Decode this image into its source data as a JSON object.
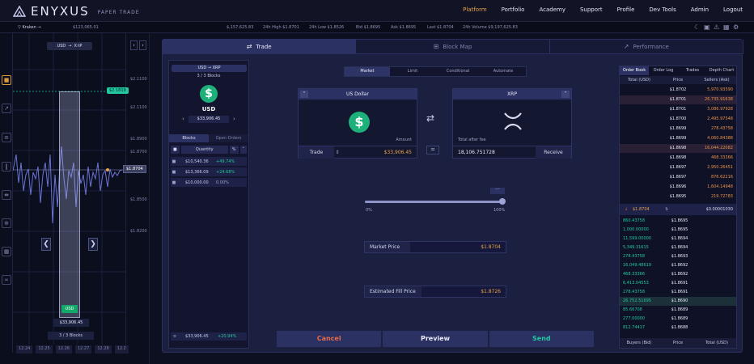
{
  "app": {
    "brand": "ENYXUS",
    "subtitle": "PAPER TRADE"
  },
  "nav": {
    "items": [
      "Platform",
      "Portfolio",
      "Academy",
      "Support",
      "Profile",
      "Dev Tools",
      "Admin",
      "Logout"
    ],
    "active": "Platform"
  },
  "ticker": {
    "exchange": "Kraken",
    "balance": "$123,065.01",
    "volume": "$,157,625.83",
    "high": "24h High  $1.8701",
    "low": "24h Low  $1.8526",
    "bid": "Bid  $1.8695",
    "ask": "Ask  $1.8695",
    "last": "Last  $1.8704",
    "vol24": "24h Volume  $9,197,625.83"
  },
  "chart": {
    "pair_from": "USD",
    "pair_to": "XRP",
    "y_labels": [
      "$2.1100",
      "$2.1100",
      "$1.8900",
      "$1.8700",
      "$1.8500",
      "$1.8200"
    ],
    "highlight_label": "$2.1819",
    "current_label": "$1.8704",
    "column_badge": "USD",
    "amount": "$33,906.45",
    "blocks": "3 / 3 Blocks",
    "x_labels": [
      "12.24",
      "12.25",
      "12.26",
      "12.27",
      "12.28",
      "12.2"
    ],
    "line_color": "#6b74d6"
  },
  "tabs": [
    {
      "label": "Trade",
      "icon": "swap-icon"
    },
    {
      "label": "Block Map",
      "icon": "block-map-icon"
    },
    {
      "label": "Performance",
      "icon": "performance-icon"
    }
  ],
  "blocks_panel": {
    "pair_from": "USD",
    "pair_to": "XRP",
    "count": "3 / 3 Blocks",
    "coin": "USD",
    "amount": "$33,906.45",
    "tabs": [
      "Blocks",
      "Open Orders"
    ],
    "head": {
      "quantity": "Quantity",
      "pct": "%"
    },
    "rows": [
      {
        "value": "$10,540.36",
        "pct": "+49.74%"
      },
      {
        "value": "$13,366.09",
        "pct": "+24.68%"
      },
      {
        "value": "$10,000.00",
        "pct": "0.00%"
      }
    ],
    "total": {
      "value": "$33,906.45",
      "pct": "+20.94%"
    }
  },
  "order_types": {
    "items": [
      "Market",
      "Limit",
      "Conditional",
      "Automate"
    ],
    "active": "Market"
  },
  "from_card": {
    "title": "US Dollar",
    "sub": "Amount",
    "action": "Trade",
    "value": "$33,906.45"
  },
  "to_card": {
    "title": "XRP",
    "sub": "Total after fee",
    "value": "18,106.751728",
    "action": "Receive"
  },
  "equals": "=",
  "slider": {
    "value": 1.0,
    "min_label": "0%",
    "max_label": "100%",
    "more": "···"
  },
  "market_price": {
    "label": "Market Price",
    "value": "$1.8704"
  },
  "fill_price": {
    "label": "Estimated Fill Price",
    "value": "$1.8726"
  },
  "actions": {
    "cancel": "Cancel",
    "preview": "Preview",
    "send": "Send"
  },
  "order_book": {
    "tabs": [
      "Order Book",
      "Order Log",
      "Trades",
      "Depth Chart"
    ],
    "active": "Order Book",
    "head": [
      "Total (USD)",
      "Price",
      "Sellers (Ask)"
    ],
    "asks": [
      {
        "total": "",
        "price": "$1.8702",
        "size": "5,970.93590"
      },
      {
        "total": "",
        "price": "$1.8701",
        "size": "26,735.91638"
      },
      {
        "total": "",
        "price": "$1.8701",
        "size": "3,086.97928"
      },
      {
        "total": "",
        "price": "$1.8700",
        "size": "2,495.97548"
      },
      {
        "total": "",
        "price": "$1.8699",
        "size": "278.43758"
      },
      {
        "total": "",
        "price": "$1.8699",
        "size": "4,060.84388"
      },
      {
        "total": "",
        "price": "$1.8698",
        "size": "16,044.22082"
      },
      {
        "total": "",
        "price": "$1.8698",
        "size": "468.33366"
      },
      {
        "total": "",
        "price": "$1.8697",
        "size": "2,950.26451"
      },
      {
        "total": "",
        "price": "$1.8697",
        "size": "876.62216"
      },
      {
        "total": "",
        "price": "$1.8696",
        "size": "1,604.14948"
      },
      {
        "total": "",
        "price": "$1.8695",
        "size": "219.72783"
      }
    ],
    "mid": {
      "price": "$1.8704",
      "spread": "$0.00001030"
    },
    "bids": [
      {
        "total": "860.43758",
        "price": "$1.8695"
      },
      {
        "total": "1,000.00000",
        "price": "$1.8695"
      },
      {
        "total": "11,599.00000",
        "price": "$1.8694"
      },
      {
        "total": "5,349.31615",
        "price": "$1.8694"
      },
      {
        "total": "278.43758",
        "price": "$1.8693"
      },
      {
        "total": "16,049.48619",
        "price": "$1.8692"
      },
      {
        "total": "468.33366",
        "price": "$1.8692"
      },
      {
        "total": "6,413.04553",
        "price": "$1.8691"
      },
      {
        "total": "278.43758",
        "price": "$1.8691"
      },
      {
        "total": "26,752.51695",
        "price": "$1.8690"
      },
      {
        "total": "85.66708",
        "price": "$1.8689"
      },
      {
        "total": "277.00000",
        "price": "$1.8689"
      },
      {
        "total": "812.74417",
        "price": "$1.8688"
      }
    ],
    "foot": [
      "Buyers (Bid)",
      "Price",
      "Total (USD)"
    ]
  }
}
